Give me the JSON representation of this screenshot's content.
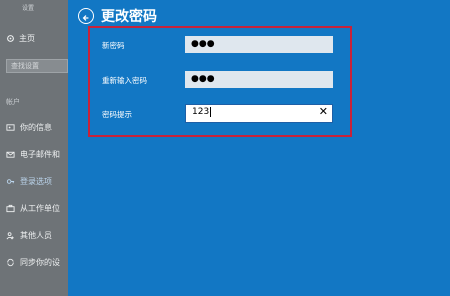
{
  "sidebar": {
    "app_title": "设置",
    "home_label": "主页",
    "search_placeholder": "查找设置",
    "section_label": "帐户",
    "items": [
      {
        "label": "你的信息"
      },
      {
        "label": "电子邮件和"
      },
      {
        "label": "登录选项"
      },
      {
        "label": "从工作单位"
      },
      {
        "label": "其他人员"
      },
      {
        "label": "同步你的设"
      }
    ]
  },
  "main": {
    "title": "更改密码",
    "fields": [
      {
        "label": "新密码",
        "value": "●●●"
      },
      {
        "label": "重新输入密码",
        "value": "●●●"
      },
      {
        "label": "密码提示",
        "value": "123"
      }
    ]
  },
  "colors": {
    "accent": "#1277c4",
    "highlight_frame": "#c8223a"
  }
}
